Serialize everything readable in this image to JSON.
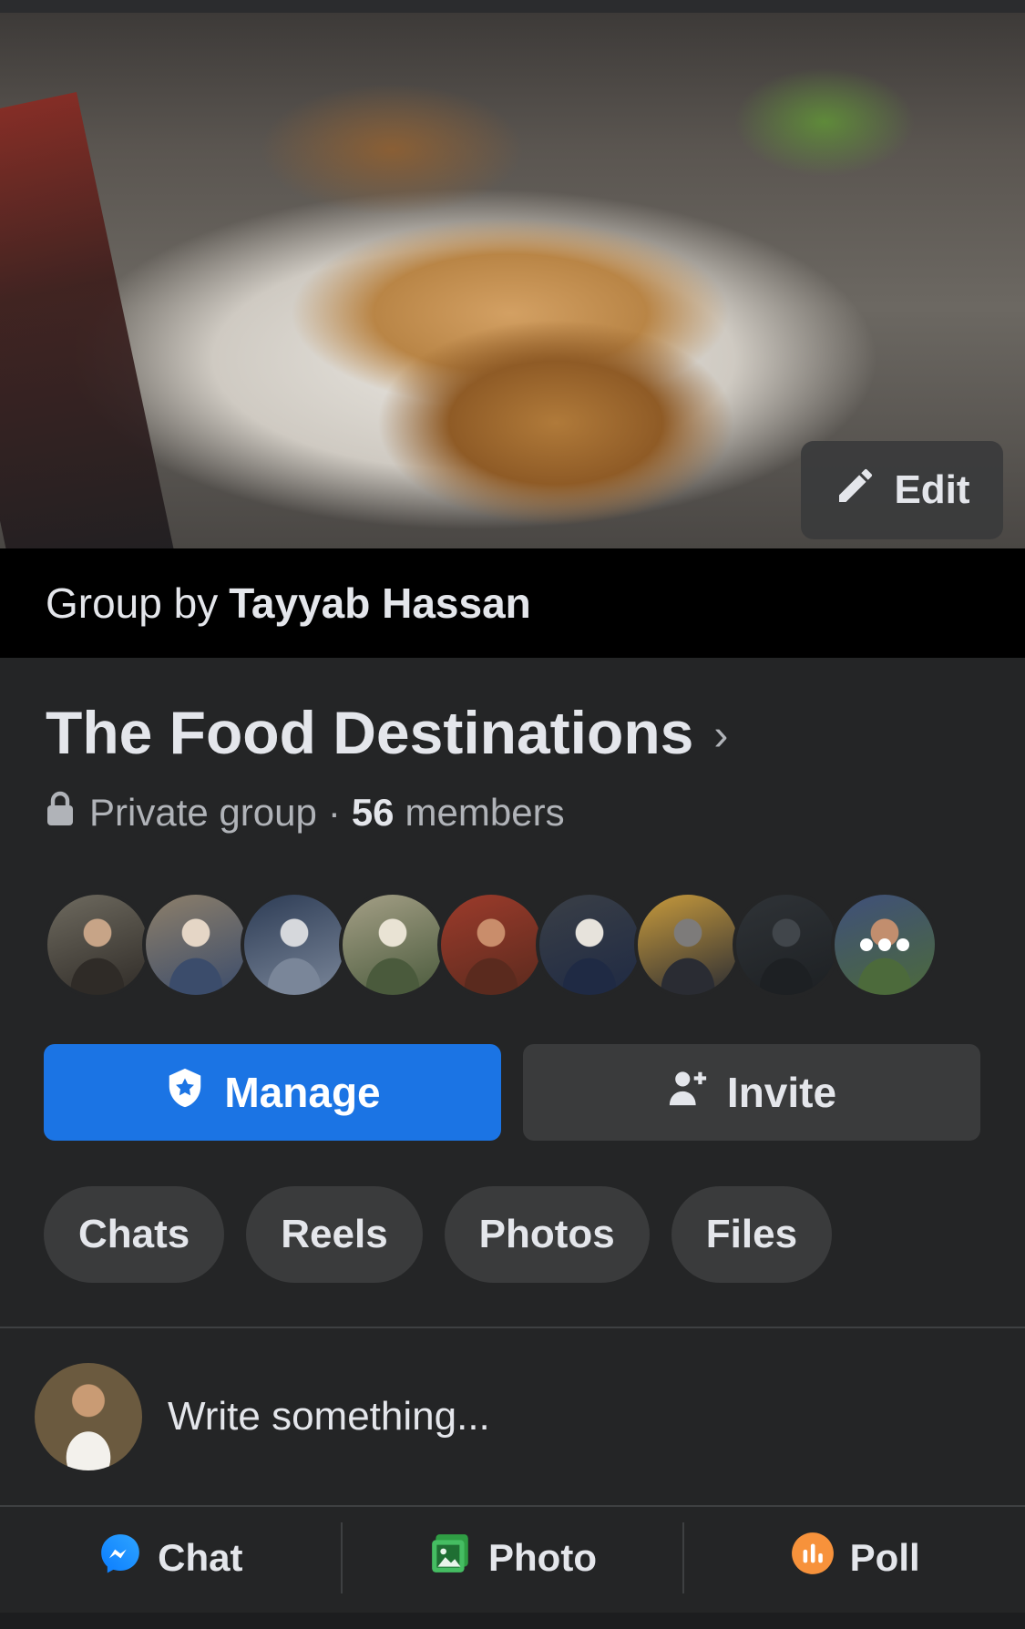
{
  "cover": {
    "edit_label": "Edit"
  },
  "owner": {
    "prefix": "Group by",
    "name": "Tayyab Hassan"
  },
  "group": {
    "name": "The Food Destinations",
    "privacy": "Private group",
    "separator": "·",
    "member_count": "56",
    "member_word": "members"
  },
  "members": [
    {
      "colors": [
        "#6e6a5f",
        "#c7a487",
        "#2f2b27"
      ]
    },
    {
      "colors": [
        "#8d7f6a",
        "#e5d6c6",
        "#3b4c6b"
      ]
    },
    {
      "colors": [
        "#2d3c55",
        "#d6d8dc",
        "#7a8699"
      ]
    },
    {
      "colors": [
        "#a49f86",
        "#e9e3d4",
        "#4a5a3c"
      ]
    },
    {
      "colors": [
        "#9c3b2b",
        "#c98d6b",
        "#5a2a1e"
      ]
    },
    {
      "colors": [
        "#3a3f46",
        "#e7e3dc",
        "#1f2a44"
      ]
    },
    {
      "colors": [
        "#c79a3c",
        "#7d7b7a",
        "#2a2c33"
      ]
    },
    {
      "colors": [
        "#2f3337",
        "#41464b",
        "#1d2023"
      ]
    },
    {
      "colors": [
        "#3f4f7a",
        "#c28e6e",
        "#4c6a3b"
      ]
    }
  ],
  "buttons": {
    "manage": "Manage",
    "invite": "Invite"
  },
  "tabs": [
    "Chats",
    "Reels",
    "Photos",
    "Files"
  ],
  "composer": {
    "placeholder": "Write something..."
  },
  "actions": {
    "chat": "Chat",
    "photo": "Photo",
    "poll": "Poll"
  },
  "colors": {
    "accent": "#1b74e4",
    "background": "#242526",
    "chip": "#3a3b3c"
  }
}
